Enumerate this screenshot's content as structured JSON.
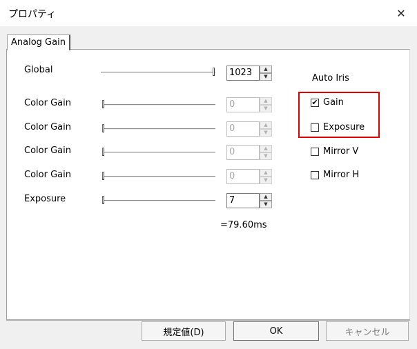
{
  "window": {
    "title": "プロパティ",
    "close_glyph": "✕"
  },
  "tab": {
    "label": "Analog Gain"
  },
  "rows": [
    {
      "label": "Global",
      "value": "1023",
      "disabled": false
    },
    {
      "label": "Color Gain",
      "value": "0",
      "disabled": true
    },
    {
      "label": "Color Gain",
      "value": "0",
      "disabled": true
    },
    {
      "label": "Color Gain",
      "value": "0",
      "disabled": true
    },
    {
      "label": "Color Gain",
      "value": "0",
      "disabled": true
    },
    {
      "label": "Exposure",
      "value": "7",
      "disabled": false
    }
  ],
  "exposure_time": "=79.60ms",
  "auto_iris": {
    "heading": "Auto Iris",
    "gain": {
      "label": "Gain",
      "checked": true
    },
    "exposure": {
      "label": "Exposure",
      "checked": false
    }
  },
  "mirror_v": {
    "label": "Mirror V",
    "checked": false
  },
  "mirror_h": {
    "label": "Mirror H",
    "checked": false
  },
  "buttons": {
    "default": "規定値(D)",
    "ok": "OK",
    "cancel": "キャンセル"
  },
  "spin_glyphs": {
    "up": "▲",
    "down": "▼"
  },
  "check_glyph": "✔",
  "highlight_color": "#e00000"
}
